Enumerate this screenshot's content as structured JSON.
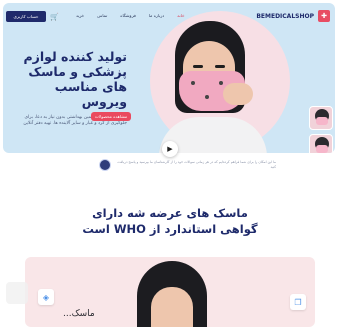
{
  "nav": {
    "brand": "BEMEDICALSHOP",
    "menu": [
      "خانه",
      "درباره ما",
      "فروشگاه",
      "تماس",
      "خرید"
    ],
    "login_label": "حساب کاربری",
    "cart_icon": "cart-icon",
    "logo_icon": "plus-cross-logo-icon"
  },
  "hero": {
    "title": "تولید کننده لوازم پزشکی و ماسک های مناسب ویروس",
    "description": "محافظت کامل، تضمین بهداشتی بدون نیاز به دعا، برای جلوگیری از گرد و غبار و سایر آلاینده ها. تهیه دفتر آنلاین",
    "button_label": "مشاهده محصولات",
    "play_icon": "play-icon"
  },
  "support": {
    "text": "ما این امکان را برای شما فراهم کرده‌ایم که در هر زمانی سوالات خود را از کارشناسان ما بپرسید و پاسخ دریافت کنید"
  },
  "section": {
    "title_line1": "ماسک های عرضه شه دارای",
    "title_line2": "گواهی استاندارد از WHO است"
  },
  "card2": {
    "fragment": "ماسک..."
  },
  "colors": {
    "primary": "#1e2a6b",
    "accent": "#ea4a5f",
    "hero_bg": "#cfe6f5",
    "card_bg": "#f9e6e8"
  }
}
